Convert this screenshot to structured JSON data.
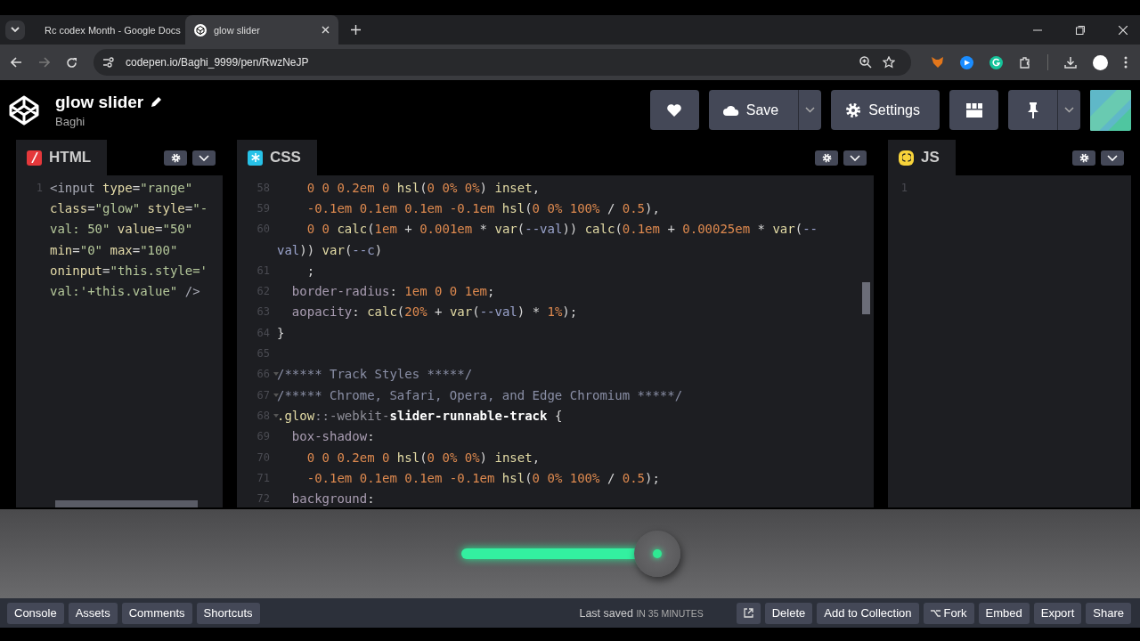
{
  "browser": {
    "tabs": [
      {
        "title": "Rc codex Month - Google Docs",
        "selected": false
      },
      {
        "title": "glow slider",
        "selected": true
      }
    ],
    "url": "codepen.io/Baghi_9999/pen/RwzNeJP"
  },
  "pen": {
    "title": "glow slider",
    "author": "Baghi",
    "buttons": [
      {
        "kind": "heart"
      },
      {
        "kind": "save",
        "label": "Save"
      },
      {
        "kind": "settings",
        "label": "Settings"
      },
      {
        "kind": "layout"
      },
      {
        "kind": "pin"
      }
    ]
  },
  "editors": [
    {
      "kind": "html",
      "label": "HTML",
      "lines": [
        {
          "number": "1",
          "tokens": [
            {
              "kind": "tag",
              "text": "<input "
            },
            {
              "kind": "attr",
              "text": "type"
            },
            {
              "kind": "punct",
              "text": "="
            },
            {
              "kind": "str",
              "text": "\"range\""
            }
          ]
        },
        {
          "tokens": [
            {
              "kind": "attr",
              "text": "class"
            },
            {
              "kind": "punct",
              "text": "="
            },
            {
              "kind": "str",
              "text": "\"glow\" "
            },
            {
              "kind": "attr",
              "text": "style"
            },
            {
              "kind": "punct",
              "text": "="
            },
            {
              "kind": "str",
              "text": "\"-"
            }
          ]
        },
        {
          "tokens": [
            {
              "kind": "str",
              "text": "val: 50\" "
            },
            {
              "kind": "attr",
              "text": "value"
            },
            {
              "kind": "punct",
              "text": "="
            },
            {
              "kind": "str",
              "text": "\"50\""
            }
          ]
        },
        {
          "tokens": [
            {
              "kind": "attr",
              "text": "min"
            },
            {
              "kind": "punct",
              "text": "="
            },
            {
              "kind": "str",
              "text": "\"0\" "
            },
            {
              "kind": "attr",
              "text": "max"
            },
            {
              "kind": "punct",
              "text": "="
            },
            {
              "kind": "str",
              "text": "\"100\""
            }
          ]
        },
        {
          "tokens": [
            {
              "kind": "attr",
              "text": "oninput"
            },
            {
              "kind": "punct",
              "text": "="
            },
            {
              "kind": "str",
              "text": "\"this.style='"
            }
          ]
        },
        {
          "tokens": [
            {
              "kind": "str",
              "text": "val:'+this.value\" "
            },
            {
              "kind": "tag",
              "text": "/>"
            }
          ]
        }
      ]
    },
    {
      "kind": "css",
      "label": "CSS",
      "lines": [
        {
          "number": "58",
          "kind": "deep",
          "tokens": [
            {
              "kind": "num",
              "text": "0 0 0.2em 0 "
            },
            {
              "kind": "func",
              "text": "hsl"
            },
            {
              "kind": "punct",
              "text": "("
            },
            {
              "kind": "num",
              "text": "0 0% 0%"
            },
            {
              "kind": "punct",
              "text": ") "
            },
            {
              "kind": "func",
              "text": "inset"
            },
            {
              "kind": "punct",
              "text": ","
            }
          ]
        },
        {
          "number": "59",
          "kind": "deep",
          "tokens": [
            {
              "kind": "num",
              "text": "-0.1em 0.1em 0.1em -0.1em "
            },
            {
              "kind": "func",
              "text": "hsl"
            },
            {
              "kind": "punct",
              "text": "("
            },
            {
              "kind": "num",
              "text": "0 0% 100%"
            },
            {
              "kind": "punct",
              "text": " / "
            },
            {
              "kind": "num",
              "text": "0.5"
            },
            {
              "kind": "punct",
              "text": "),"
            }
          ]
        },
        {
          "number": "60",
          "kind": "deep",
          "tokens": [
            {
              "kind": "num",
              "text": "0 0 "
            },
            {
              "kind": "func",
              "text": "calc"
            },
            {
              "kind": "punct",
              "text": "("
            },
            {
              "kind": "num",
              "text": "1em"
            },
            {
              "kind": "punct",
              "text": " + "
            },
            {
              "kind": "num",
              "text": "0.001em"
            },
            {
              "kind": "punct",
              "text": " * "
            },
            {
              "kind": "func",
              "text": "var"
            },
            {
              "kind": "punct",
              "text": "("
            },
            {
              "kind": "var",
              "text": "--val"
            },
            {
              "kind": "punct",
              "text": ")) "
            },
            {
              "kind": "func",
              "text": "calc"
            },
            {
              "kind": "punct",
              "text": "("
            },
            {
              "kind": "num",
              "text": "0.1em"
            },
            {
              "kind": "punct",
              "text": " + "
            },
            {
              "kind": "num",
              "text": "0.00025em"
            },
            {
              "kind": "punct",
              "text": " * "
            },
            {
              "kind": "func",
              "text": "var"
            },
            {
              "kind": "punct",
              "text": "("
            },
            {
              "kind": "var",
              "text": "--"
            }
          ]
        },
        {
          "kind": "top",
          "tokens": [
            {
              "kind": "var",
              "text": "val"
            },
            {
              "kind": "punct",
              "text": ")) "
            },
            {
              "kind": "func",
              "text": "var"
            },
            {
              "kind": "punct",
              "text": "("
            },
            {
              "kind": "var",
              "text": "--c"
            },
            {
              "kind": "punct",
              "text": ")"
            }
          ]
        },
        {
          "number": "61",
          "kind": "deep",
          "tokens": [
            {
              "kind": "punct",
              "text": ";"
            }
          ]
        },
        {
          "number": "62",
          "kind": "inner",
          "tokens": [
            {
              "kind": "prop",
              "text": "border-radius"
            },
            {
              "kind": "punct",
              "text": ": "
            },
            {
              "kind": "num",
              "text": "1em 0 0 1em"
            },
            {
              "kind": "punct",
              "text": ";"
            }
          ]
        },
        {
          "number": "63",
          "kind": "inner",
          "tokens": [
            {
              "kind": "prop",
              "text": "aopacity"
            },
            {
              "kind": "punct",
              "text": ": "
            },
            {
              "kind": "func",
              "text": "calc"
            },
            {
              "kind": "punct",
              "text": "("
            },
            {
              "kind": "num",
              "text": "20%"
            },
            {
              "kind": "punct",
              "text": " + "
            },
            {
              "kind": "func",
              "text": "var"
            },
            {
              "kind": "punct",
              "text": "("
            },
            {
              "kind": "var",
              "text": "--val"
            },
            {
              "kind": "punct",
              "text": ") * "
            },
            {
              "kind": "num",
              "text": "1%"
            },
            {
              "kind": "punct",
              "text": ");"
            }
          ]
        },
        {
          "number": "64",
          "kind": "top",
          "tokens": [
            {
              "kind": "punct",
              "text": "}"
            }
          ]
        },
        {
          "number": "65"
        },
        {
          "number": "66",
          "kind": "top",
          "fold": true,
          "tokens": [
            {
              "kind": "comment",
              "text": "/***** Track Styles *****/"
            }
          ]
        },
        {
          "number": "67",
          "kind": "top",
          "fold": true,
          "tokens": [
            {
              "kind": "comment",
              "text": "/***** Chrome, Safari, Opera, and Edge Chromium *****/"
            }
          ]
        },
        {
          "number": "68",
          "kind": "top",
          "fold": true,
          "tokens": [
            {
              "kind": "sel",
              "text": ".glow"
            },
            {
              "kind": "pseudo",
              "text": "::-webkit-"
            },
            {
              "kind": "bold",
              "text": "slider-runnable-track"
            },
            {
              "kind": "punct",
              "text": " {"
            }
          ]
        },
        {
          "number": "69",
          "kind": "inner",
          "tokens": [
            {
              "kind": "prop",
              "text": "box-shadow"
            },
            {
              "kind": "punct",
              "text": ":"
            }
          ]
        },
        {
          "number": "70",
          "kind": "deep",
          "tokens": [
            {
              "kind": "num",
              "text": "0 0 0.2em 0 "
            },
            {
              "kind": "func",
              "text": "hsl"
            },
            {
              "kind": "punct",
              "text": "("
            },
            {
              "kind": "num",
              "text": "0 0% 0%"
            },
            {
              "kind": "punct",
              "text": ") "
            },
            {
              "kind": "func",
              "text": "inset"
            },
            {
              "kind": "punct",
              "text": ","
            }
          ]
        },
        {
          "number": "71",
          "kind": "deep",
          "tokens": [
            {
              "kind": "num",
              "text": "-0.1em 0.1em 0.1em -0.1em "
            },
            {
              "kind": "func",
              "text": "hsl"
            },
            {
              "kind": "punct",
              "text": "("
            },
            {
              "kind": "num",
              "text": "0 0% 100%"
            },
            {
              "kind": "punct",
              "text": " / "
            },
            {
              "kind": "num",
              "text": "0.5"
            },
            {
              "kind": "punct",
              "text": ");"
            }
          ]
        },
        {
          "number": "72",
          "kind": "inner",
          "tokens": [
            {
              "kind": "prop",
              "text": "background"
            },
            {
              "kind": "punct",
              "text": ":"
            }
          ]
        }
      ]
    },
    {
      "kind": "js",
      "label": "JS",
      "lines": [
        {
          "number": "1"
        }
      ]
    }
  ],
  "preview": {
    "slider": {
      "level": 0.9
    }
  },
  "footer": {
    "left": [
      "Console",
      "Assets",
      "Comments",
      "Shortcuts"
    ],
    "saved_label": "Last saved",
    "saved_time": "IN 35 MINUTES",
    "right": [
      {
        "kind": "external"
      },
      {
        "kind": "text",
        "label": "Delete"
      },
      {
        "kind": "text",
        "label": "Add to Collection"
      },
      {
        "kind": "fork",
        "label": "Fork"
      },
      {
        "kind": "text",
        "label": "Embed"
      },
      {
        "kind": "text",
        "label": "Export"
      },
      {
        "kind": "text",
        "label": "Share"
      }
    ]
  }
}
